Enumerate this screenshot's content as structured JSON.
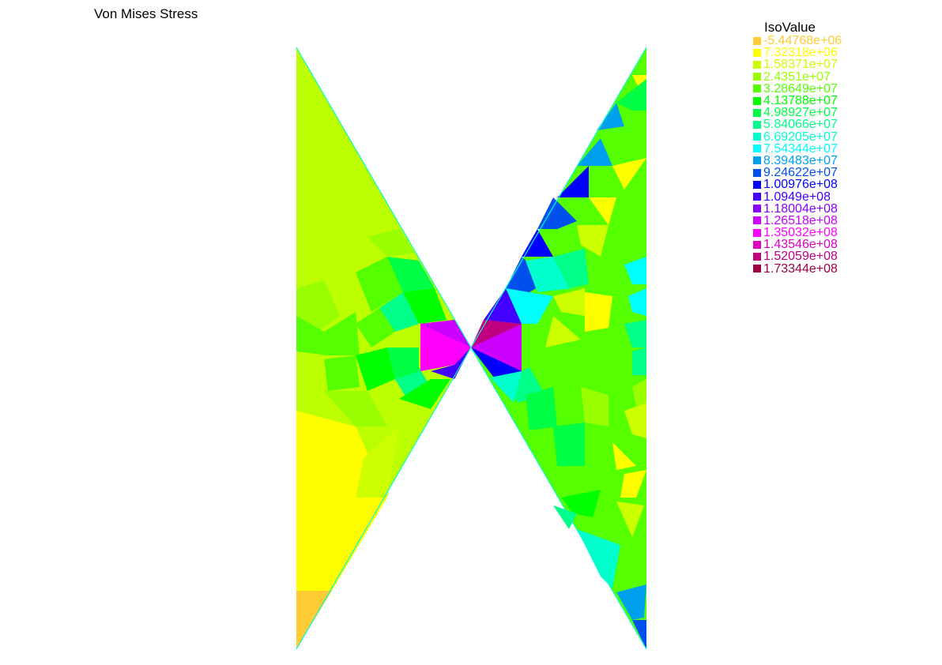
{
  "title": "Von Mises Stress",
  "legend": {
    "title": "IsoValue",
    "entries": [
      {
        "label": "-5.44768e+06",
        "color": "#ffcc33"
      },
      {
        "label": "7.32318e+06",
        "color": "#ffff00"
      },
      {
        "label": "1.58371e+07",
        "color": "#ccff00"
      },
      {
        "label": "2.4351e+07",
        "color": "#99ff00"
      },
      {
        "label": "3.28649e+07",
        "color": "#55ff00"
      },
      {
        "label": "4.13788e+07",
        "color": "#00ff00"
      },
      {
        "label": "4.98927e+07",
        "color": "#00ff44"
      },
      {
        "label": "5.84066e+07",
        "color": "#00ff88"
      },
      {
        "label": "6.69205e+07",
        "color": "#00ffcc"
      },
      {
        "label": "7.54344e+07",
        "color": "#00ffff"
      },
      {
        "label": "8.39483e+07",
        "color": "#00a0ee"
      },
      {
        "label": "9.24622e+07",
        "color": "#0050ee"
      },
      {
        "label": "1.00976e+08",
        "color": "#0000ff"
      },
      {
        "label": "1.0949e+08",
        "color": "#4400ff"
      },
      {
        "label": "1.18004e+08",
        "color": "#8800ff"
      },
      {
        "label": "1.26518e+08",
        "color": "#cc00ff"
      },
      {
        "label": "1.35032e+08",
        "color": "#ff00ff"
      },
      {
        "label": "1.43546e+08",
        "color": "#e000c0"
      },
      {
        "label": "1.52059e+08",
        "color": "#c00080"
      },
      {
        "label": "1.73344e+08",
        "color": "#a00040"
      }
    ]
  }
}
